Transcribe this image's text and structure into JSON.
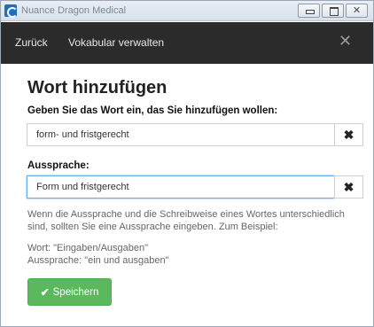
{
  "window": {
    "title": "Nuance Dragon Medical",
    "minimize_label": "",
    "maximize_label": "",
    "close_label": "✕"
  },
  "navbar": {
    "back_label": "Zurück",
    "vocabulary_label": "Vokabular verwalten",
    "close_label": "✕"
  },
  "page": {
    "title": "Wort hinzufügen",
    "word_label": "Geben Sie das Wort ein, das Sie hinzufügen wollen:",
    "word_value": "form- und fristgerecht",
    "pronunciation_label": "Aussprache:",
    "pronunciation_value": "Form und fristgerecht",
    "clear_icon": "✖",
    "help_text": "Wenn die Aussprache und die Schreibweise eines Wortes unterschiedlich sind, sollten Sie eine Aussprache eingeben. Zum Beispiel:",
    "example_word": "Wort: \"Eingaben/Ausgaben\"",
    "example_pronunciation": "Aussprache: \"ein und ausgaben\"",
    "save_label": "Speichern",
    "save_icon": "✔"
  },
  "colors": {
    "navbar": "#2b2b2b",
    "save_button": "#5cb85c",
    "focus_border": "#66afe9"
  }
}
